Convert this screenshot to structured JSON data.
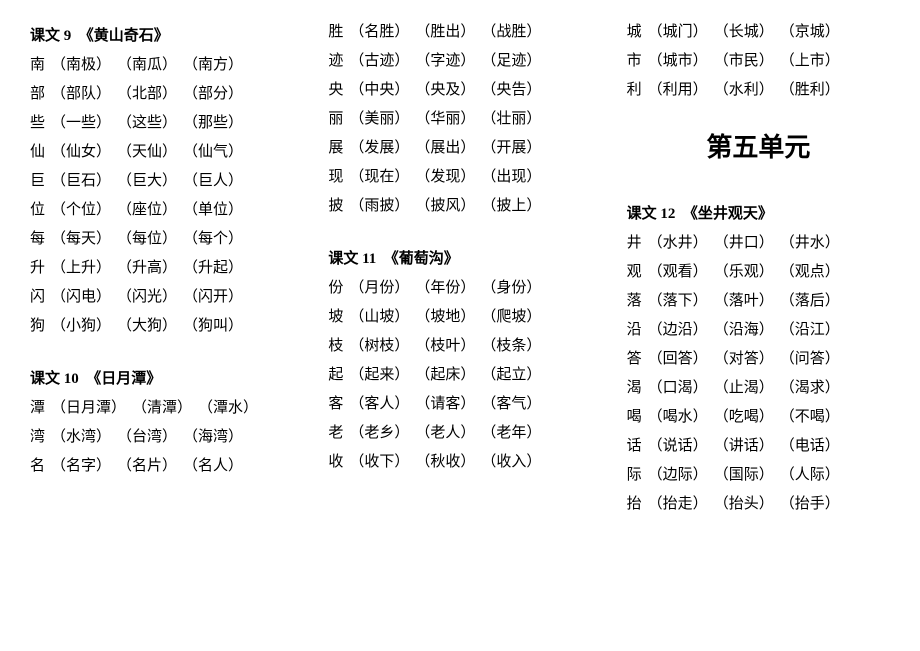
{
  "columns": [
    {
      "blocks": [
        {
          "type": "lesson",
          "title": "课文 9　《黄山奇石》",
          "entries": [
            {
              "head": "南",
              "words": [
                "南极",
                "南瓜",
                "南方"
              ]
            },
            {
              "head": "部",
              "words": [
                "部队",
                "北部",
                "部分"
              ]
            },
            {
              "head": "些",
              "words": [
                "一些",
                "这些",
                "那些"
              ]
            },
            {
              "head": "仙",
              "words": [
                "仙女",
                "天仙",
                "仙气"
              ]
            },
            {
              "head": "巨",
              "words": [
                "巨石",
                "巨大",
                "巨人"
              ]
            },
            {
              "head": "位",
              "words": [
                "个位",
                "座位",
                "单位"
              ]
            },
            {
              "head": "每",
              "words": [
                "每天",
                "每位",
                "每个"
              ]
            },
            {
              "head": "升",
              "words": [
                "上升",
                "升高",
                "升起"
              ]
            },
            {
              "head": "闪",
              "words": [
                "闪电",
                "闪光",
                "闪开"
              ]
            },
            {
              "head": "狗",
              "words": [
                "小狗",
                "大狗",
                "狗叫"
              ]
            }
          ]
        },
        {
          "type": "lesson",
          "title": "课文 10　《日月潭》",
          "entries": [
            {
              "head": "潭",
              "words": [
                "日月潭",
                "清潭",
                "潭水"
              ]
            },
            {
              "head": "湾",
              "words": [
                "水湾",
                "台湾",
                "海湾"
              ]
            },
            {
              "head": "名",
              "words": [
                "名字",
                "名片",
                "名人"
              ]
            }
          ]
        }
      ]
    },
    {
      "blocks": [
        {
          "type": "entries",
          "entries": [
            {
              "head": "胜",
              "words": [
                "名胜",
                "胜出",
                "战胜"
              ]
            },
            {
              "head": "迹",
              "words": [
                "古迹",
                "字迹",
                "足迹"
              ]
            },
            {
              "head": "央",
              "words": [
                "中央",
                "央及",
                "央告"
              ]
            },
            {
              "head": "丽",
              "words": [
                "美丽",
                "华丽",
                "壮丽"
              ]
            },
            {
              "head": "展",
              "words": [
                "发展",
                "展出",
                "开展"
              ]
            },
            {
              "head": "现",
              "words": [
                "现在",
                "发现",
                "出现"
              ]
            },
            {
              "head": "披",
              "words": [
                "雨披",
                "披风",
                "披上"
              ]
            }
          ]
        },
        {
          "type": "lesson",
          "title": "课文 11　《葡萄沟》",
          "entries": [
            {
              "head": "份",
              "words": [
                "月份",
                "年份",
                "身份"
              ]
            },
            {
              "head": "坡",
              "words": [
                "山坡",
                "坡地",
                "爬坡"
              ]
            },
            {
              "head": "枝",
              "words": [
                "树枝",
                "枝叶",
                "枝条"
              ]
            },
            {
              "head": "起",
              "words": [
                "起来",
                "起床",
                "起立"
              ]
            },
            {
              "head": "客",
              "words": [
                "客人",
                "请客",
                "客气"
              ]
            },
            {
              "head": "老",
              "words": [
                "老乡",
                "老人",
                "老年"
              ]
            },
            {
              "head": "收",
              "words": [
                "收下",
                "秋收",
                "收入"
              ]
            }
          ]
        }
      ]
    },
    {
      "blocks": [
        {
          "type": "entries",
          "entries": [
            {
              "head": "城",
              "words": [
                "城门",
                "长城",
                "京城"
              ]
            },
            {
              "head": "市",
              "words": [
                "城市",
                "市民",
                "上市"
              ]
            },
            {
              "head": "利",
              "words": [
                "利用",
                "水利",
                "胜利"
              ]
            }
          ]
        },
        {
          "type": "unit",
          "title": "第五单元"
        },
        {
          "type": "lesson",
          "title": "课文 12　《坐井观天》",
          "entries": [
            {
              "head": "井",
              "words": [
                "水井",
                "井口",
                "井水"
              ]
            },
            {
              "head": "观",
              "words": [
                "观看",
                "乐观",
                "观点"
              ]
            },
            {
              "head": "落",
              "words": [
                "落下",
                "落叶",
                "落后"
              ]
            },
            {
              "head": "沿",
              "words": [
                "边沿",
                "沿海",
                "沿江"
              ]
            },
            {
              "head": "答",
              "words": [
                "回答",
                "对答",
                "问答"
              ]
            },
            {
              "head": "渴",
              "words": [
                "口渴",
                "止渴",
                "渴求"
              ]
            },
            {
              "head": "喝",
              "words": [
                "喝水",
                "吃喝",
                "不喝"
              ]
            },
            {
              "head": "话",
              "words": [
                "说话",
                "讲话",
                "电话"
              ]
            },
            {
              "head": "际",
              "words": [
                "边际",
                "国际",
                "人际"
              ]
            },
            {
              "head": "抬",
              "words": [
                "抬走",
                "抬头",
                "抬手"
              ]
            }
          ]
        }
      ]
    }
  ]
}
